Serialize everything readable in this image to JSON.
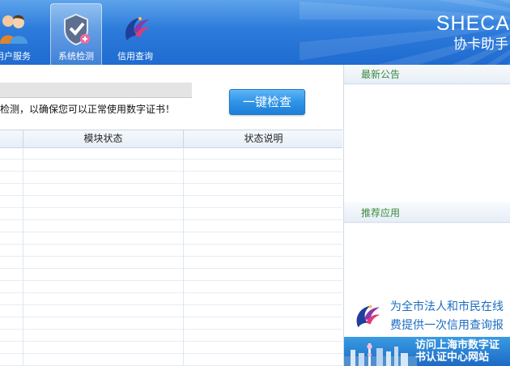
{
  "header": {
    "nav": [
      {
        "label": "用户服务",
        "icon": "users-icon"
      },
      {
        "label": "系统检测",
        "icon": "shield-check-icon",
        "active": true
      },
      {
        "label": "信用查询",
        "icon": "phoenix-icon"
      }
    ],
    "brand_title": "SHECA",
    "brand_subtitle": "协卡助手"
  },
  "check": {
    "hint": "检测，以确保您可以正常使用数字证书！",
    "button_label": "一键检查"
  },
  "table": {
    "columns": [
      "模块状态",
      "状态说明"
    ],
    "rows": []
  },
  "right": {
    "announcement_title": "最新公告",
    "recommend_title": "推荐应用",
    "promo_line1": "为全市法人和市民在线",
    "promo_line2": "费提供一次信用查询报",
    "banner_line1": "访问上海市数字证",
    "banner_line2": "书认证中心网站"
  },
  "colors": {
    "header_blue": "#2a78d9",
    "button_blue": "#2f93e8",
    "panel_title_green": "#3a8a3e",
    "promo_blue": "#1c6cc0"
  }
}
